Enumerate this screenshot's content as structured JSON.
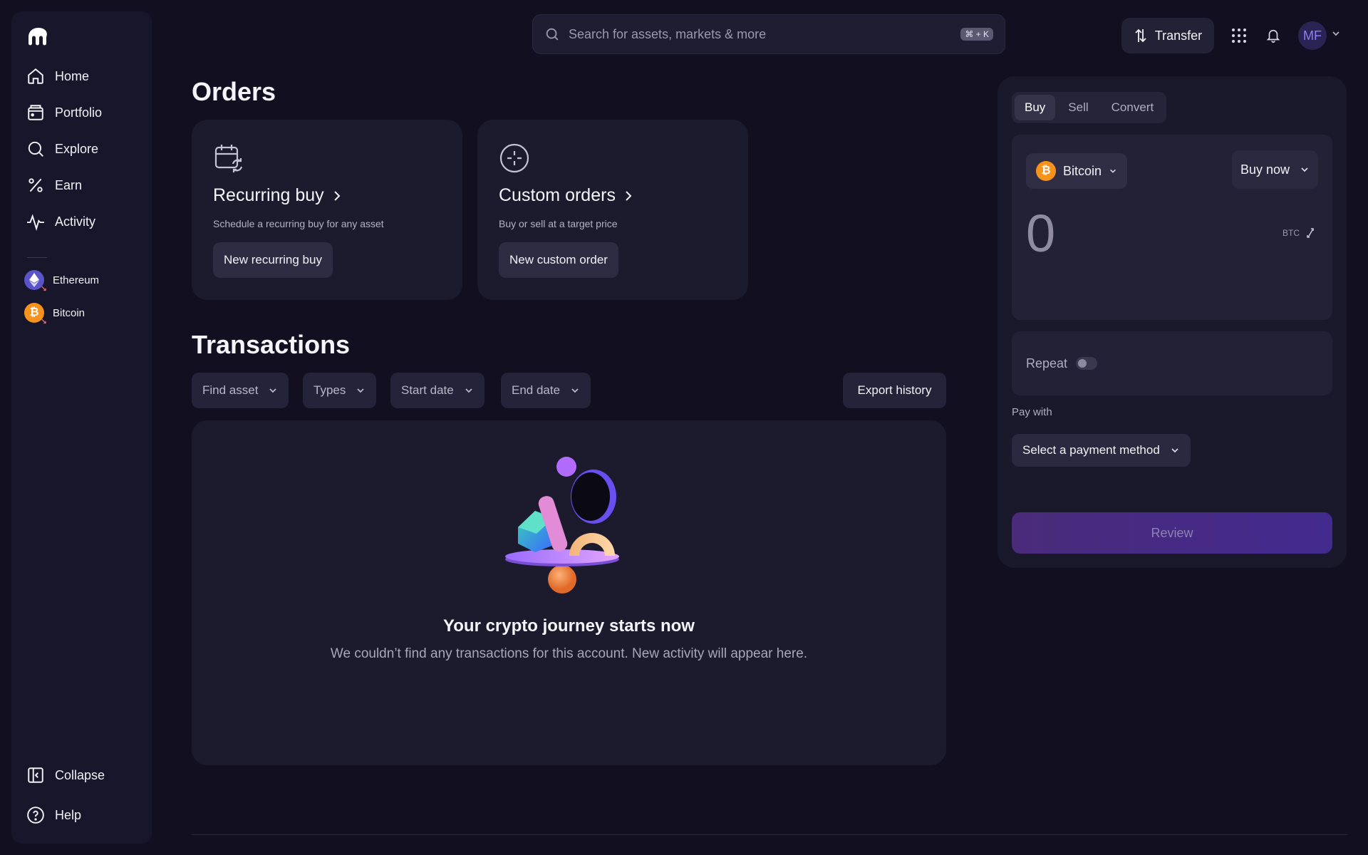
{
  "sidebar": {
    "nav": [
      {
        "label": "Home",
        "icon": "home-icon"
      },
      {
        "label": "Portfolio",
        "icon": "wallet-icon"
      },
      {
        "label": "Explore",
        "icon": "search-icon"
      },
      {
        "label": "Earn",
        "icon": "percent-icon"
      },
      {
        "label": "Activity",
        "icon": "activity-icon"
      }
    ],
    "assets": [
      {
        "label": "Ethereum",
        "icon": "ethereum-icon",
        "color": "#5b54c8"
      },
      {
        "label": "Bitcoin",
        "icon": "bitcoin-icon",
        "color": "#f7931a"
      }
    ],
    "collapse_label": "Collapse",
    "help_label": "Help"
  },
  "topbar": {
    "search_placeholder": "Search for assets, markets & more",
    "shortcut": "⌘ + K",
    "transfer_label": "Transfer",
    "avatar_initials": "MF"
  },
  "orders": {
    "title": "Orders",
    "cards": [
      {
        "title": "Recurring buy",
        "subtitle": "Schedule a recurring buy for any asset",
        "button": "New recurring buy"
      },
      {
        "title": "Custom orders",
        "subtitle": "Buy or sell at a target price",
        "button": "New custom order"
      }
    ]
  },
  "transactions": {
    "title": "Transactions",
    "filters": [
      "Find asset",
      "Types",
      "Start date",
      "End date"
    ],
    "export_label": "Export history",
    "empty_title": "Your crypto journey starts now",
    "empty_subtitle": "We couldn’t find any transactions for this account. New activity will appear here."
  },
  "trade": {
    "tabs": [
      "Buy",
      "Sell",
      "Convert"
    ],
    "active_tab": "Buy",
    "asset": "Bitcoin",
    "order_type": "Buy now",
    "amount": "0",
    "unit": "BTC",
    "repeat_label": "Repeat",
    "repeat_on": false,
    "pay_with_label": "Pay with",
    "payment_placeholder": "Select a payment method",
    "review_label": "Review"
  },
  "colors": {
    "background": "#121020",
    "accent": "#7b5cff",
    "bitcoin": "#f7931a"
  }
}
